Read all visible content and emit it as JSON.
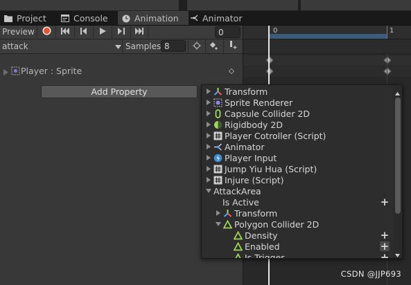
{
  "tabs": [
    {
      "label": "Project",
      "icon": "folder-icon",
      "active": false
    },
    {
      "label": "Console",
      "icon": "console-icon",
      "active": false
    },
    {
      "label": "Animation",
      "icon": "clock-icon",
      "active": true
    },
    {
      "label": "Animator",
      "icon": "animator-icon",
      "active": false
    }
  ],
  "toolbar": {
    "preview_label": "Preview",
    "frame_value": "0",
    "clip_name": "attack",
    "samples_label": "Samples",
    "samples_value": "8"
  },
  "timeline": {
    "ruler_labels": [
      "0",
      "1"
    ],
    "playhead_color": "#e8e8e8"
  },
  "property": {
    "label": "Player : Sprite",
    "add_property_label": "Add Property"
  },
  "popup": {
    "items": [
      {
        "label": "Transform",
        "icon": "transform-icon",
        "has_add": false
      },
      {
        "label": "Sprite Renderer",
        "icon": "sprite-renderer-icon",
        "has_add": false
      },
      {
        "label": "Capsule Collider 2D",
        "icon": "capsule-collider-icon",
        "has_add": false
      },
      {
        "label": "Rigidbody 2D",
        "icon": "rigidbody-icon",
        "has_add": false
      },
      {
        "label": "Player Cotroller (Script)",
        "icon": "script-icon",
        "has_add": false
      },
      {
        "label": "Animator",
        "icon": "animator-icon",
        "has_add": false
      },
      {
        "label": "Player Input",
        "icon": "player-input-icon",
        "has_add": false
      },
      {
        "label": "Jump Yiu Hua (Script)",
        "icon": "script-icon",
        "has_add": false
      },
      {
        "label": "Injure (Script)",
        "icon": "script-icon",
        "has_add": false
      },
      {
        "label": "AttackArea",
        "icon": "none",
        "has_add": false
      },
      {
        "label": "Is Active",
        "icon": "none",
        "has_add": true
      },
      {
        "label": "Transform",
        "icon": "transform-icon",
        "has_add": false
      },
      {
        "label": "Polygon Collider 2D",
        "icon": "polygon-collider-icon",
        "has_add": false
      },
      {
        "label": "Density",
        "icon": "polygon-collider-icon",
        "has_add": true
      },
      {
        "label": "Enabled",
        "icon": "polygon-collider-icon",
        "has_add": true
      },
      {
        "label": "Is Trigger",
        "icon": "polygon-collider-icon",
        "has_add": true
      }
    ]
  },
  "watermark": "CSDN @JJP693",
  "colors": {
    "record_red": "#e4572e",
    "collider_green": "#9fd85a",
    "script_gray": "#cfcfcf",
    "timeline_blue": "#3b5d7a"
  }
}
